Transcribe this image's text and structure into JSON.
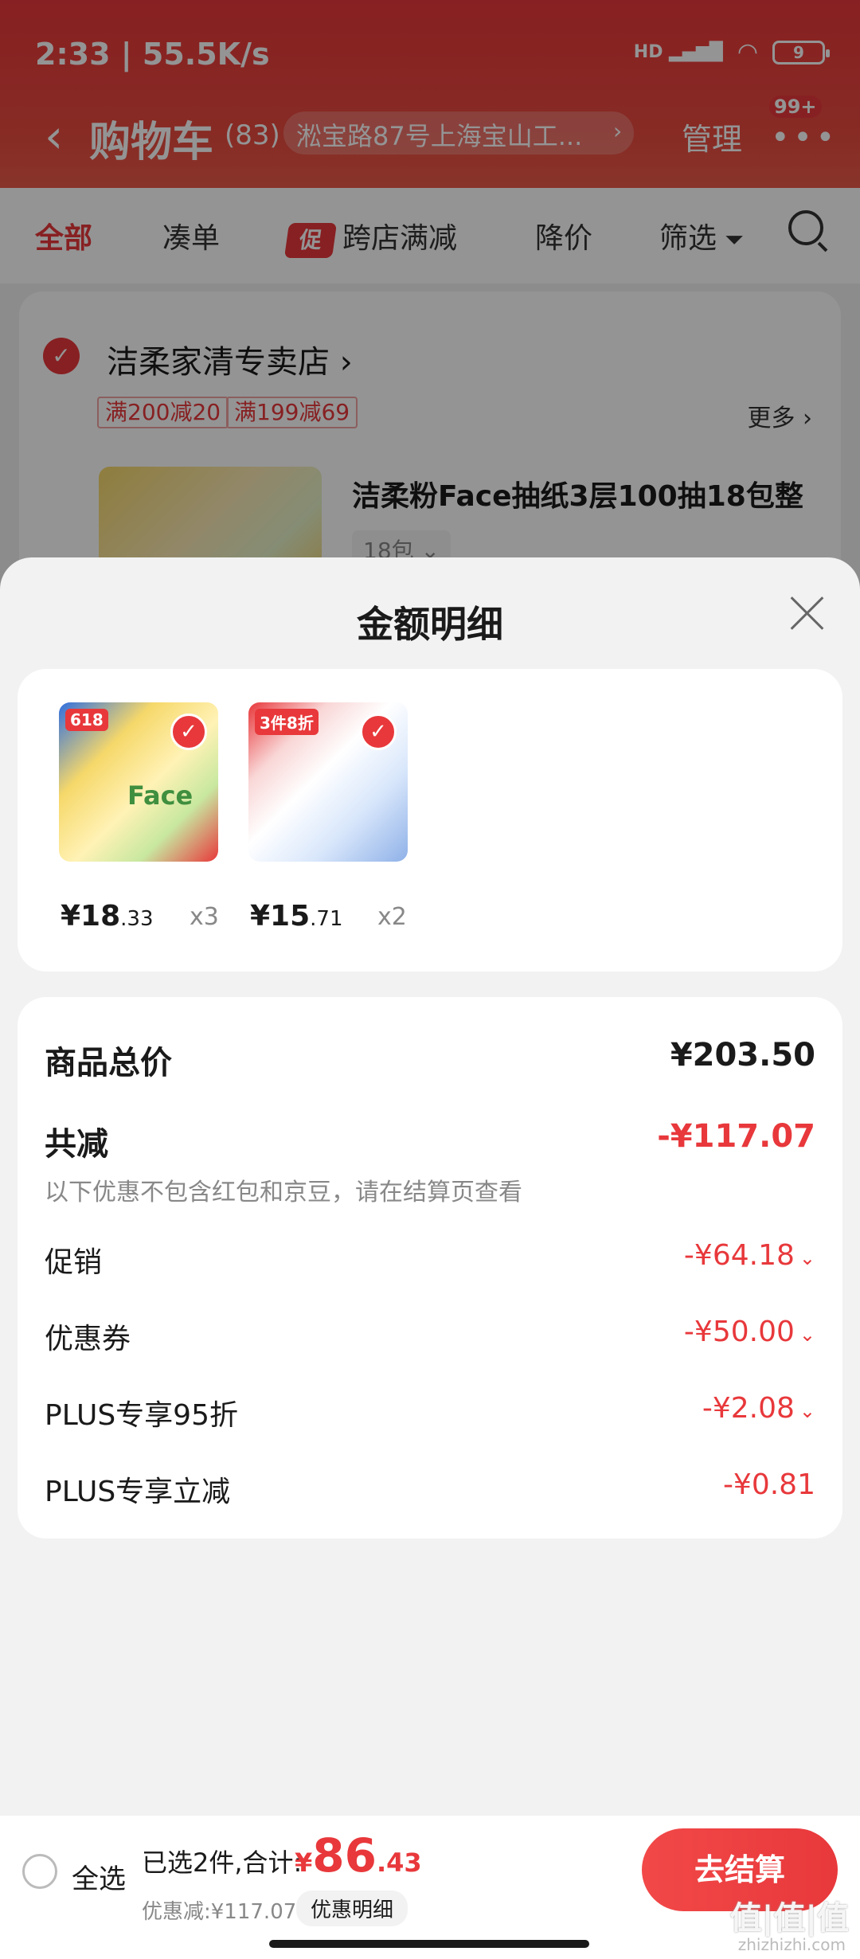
{
  "status_bar": {
    "time": "2:33",
    "speed": "55.5K/s",
    "network": "HD",
    "battery": "9"
  },
  "header": {
    "title": "购物车",
    "count": "(83)",
    "address": "淞宝路87号上海宝山工...",
    "manage": "管理",
    "badge": "99+"
  },
  "tabs": {
    "all": "全部",
    "combine": "凑单",
    "promo_chip": "促",
    "cross_store": "跨店满减",
    "price_drop": "降价",
    "filter": "筛选"
  },
  "store": {
    "name": "洁柔家清专卖店",
    "coupons": [
      "满200减20",
      "满199减69"
    ],
    "more": "更多",
    "product_title": "洁柔粉Face抽纸3层100抽18包整",
    "spec": "18包"
  },
  "sheet": {
    "title": "金额明细",
    "items": [
      {
        "price_int": "¥18",
        "price_dec": ".33",
        "qty": "x3",
        "label": "618",
        "face": "Face"
      },
      {
        "price_int": "¥15",
        "price_dec": ".71",
        "qty": "x2",
        "label": "3件8折"
      }
    ],
    "total_label": "商品总价",
    "total_value": "¥203.50",
    "discount_label": "共减",
    "discount_value": "-¥117.07",
    "discount_note": "以下优惠不包含红包和京豆，请在结算页查看",
    "rows": [
      {
        "label": "促销",
        "value": "-¥64.18",
        "expandable": true
      },
      {
        "label": "优惠券",
        "value": "-¥50.00",
        "expandable": true
      },
      {
        "label": "PLUS专享95折",
        "value": "-¥2.08",
        "expandable": true
      },
      {
        "label": "PLUS专享立减",
        "value": "-¥0.81",
        "expandable": false
      }
    ]
  },
  "bottom_bar": {
    "select_all": "全选",
    "summary": "已选2件,合计:",
    "currency": "¥",
    "total_int": "86",
    "total_dec": ".43",
    "discount_line": "优惠减:¥117.07",
    "detail_button": "优惠明细",
    "checkout": "去结算"
  },
  "watermark": {
    "text": "值|值|值",
    "url": "zhizhizhi.com"
  },
  "colors": {
    "accent": "#e8383b",
    "muted": "#888888"
  }
}
